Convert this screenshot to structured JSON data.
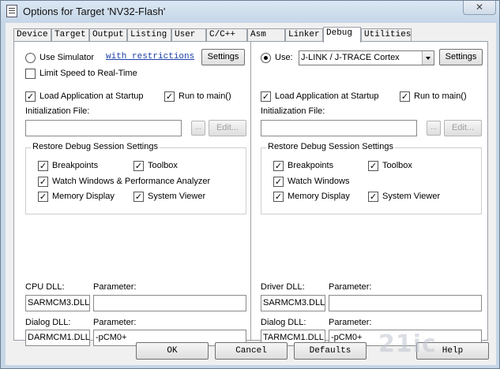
{
  "window": {
    "title": "Options for Target 'NV32-Flash'",
    "close_glyph": "✕"
  },
  "tabs": [
    {
      "label": "Device",
      "active": false
    },
    {
      "label": "Target",
      "active": false
    },
    {
      "label": "Output",
      "active": false
    },
    {
      "label": "Listing",
      "active": false
    },
    {
      "label": "User",
      "active": false
    },
    {
      "label": "C/C++",
      "active": false
    },
    {
      "label": "Asm",
      "active": false
    },
    {
      "label": "Linker",
      "active": false
    },
    {
      "label": "Debug",
      "active": true
    },
    {
      "label": "Utilities",
      "active": false
    }
  ],
  "left": {
    "use_simulator": {
      "label": "Use Simulator",
      "selected": false
    },
    "restrictions_link": "with restrictions",
    "settings_label": "Settings",
    "limit_speed": {
      "label": "Limit Speed to Real-Time",
      "checked": false
    },
    "load_app": {
      "label": "Load Application at Startup",
      "checked": true
    },
    "run_to_main": {
      "label": "Run to main()",
      "checked": true
    },
    "init_file_label": "Initialization File:",
    "init_file_value": "",
    "browse_label": "...",
    "edit_label": "Edit...",
    "restore_group_title": "Restore Debug Session Settings",
    "breakpoints": {
      "label": "Breakpoints",
      "checked": true
    },
    "toolbox": {
      "label": "Toolbox",
      "checked": true
    },
    "watch_windows": {
      "label": "Watch Windows & Performance Analyzer",
      "checked": true
    },
    "memory_display": {
      "label": "Memory Display",
      "checked": true
    },
    "system_viewer": {
      "label": "System Viewer",
      "checked": true
    },
    "dll_label": "CPU DLL:",
    "dll_param_label": "Parameter:",
    "dll_value": "SARMCM3.DLL",
    "dll_param_value": "",
    "dialog_dll_label": "Dialog DLL:",
    "dialog_param_label": "Parameter:",
    "dialog_dll_value": "DARMCM1.DLL",
    "dialog_param_value": "-pCM0+"
  },
  "right": {
    "use": {
      "label": "Use:",
      "selected": true
    },
    "driver": "J-LINK / J-TRACE Cortex",
    "settings_label": "Settings",
    "load_app": {
      "label": "Load Application at Startup",
      "checked": true
    },
    "run_to_main": {
      "label": "Run to main()",
      "checked": true
    },
    "init_file_label": "Initialization File:",
    "init_file_value": "",
    "browse_label": "...",
    "edit_label": "Edit...",
    "restore_group_title": "Restore Debug Session Settings",
    "breakpoints": {
      "label": "Breakpoints",
      "checked": true
    },
    "toolbox": {
      "label": "Toolbox",
      "checked": true
    },
    "watch_windows": {
      "label": "Watch Windows",
      "checked": true
    },
    "memory_display": {
      "label": "Memory Display",
      "checked": true
    },
    "system_viewer": {
      "label": "System Viewer",
      "checked": true
    },
    "dll_label": "Driver DLL:",
    "dll_param_label": "Parameter:",
    "dll_value": "SARMCM3.DLL",
    "dll_param_value": "",
    "dialog_dll_label": "Dialog DLL:",
    "dialog_param_label": "Parameter:",
    "dialog_dll_value": "TARMCM1.DLL",
    "dialog_param_value": "-pCM0+"
  },
  "footer": {
    "ok": "OK",
    "cancel": "Cancel",
    "defaults": "Defaults",
    "help": "Help"
  },
  "watermark": "21ic"
}
